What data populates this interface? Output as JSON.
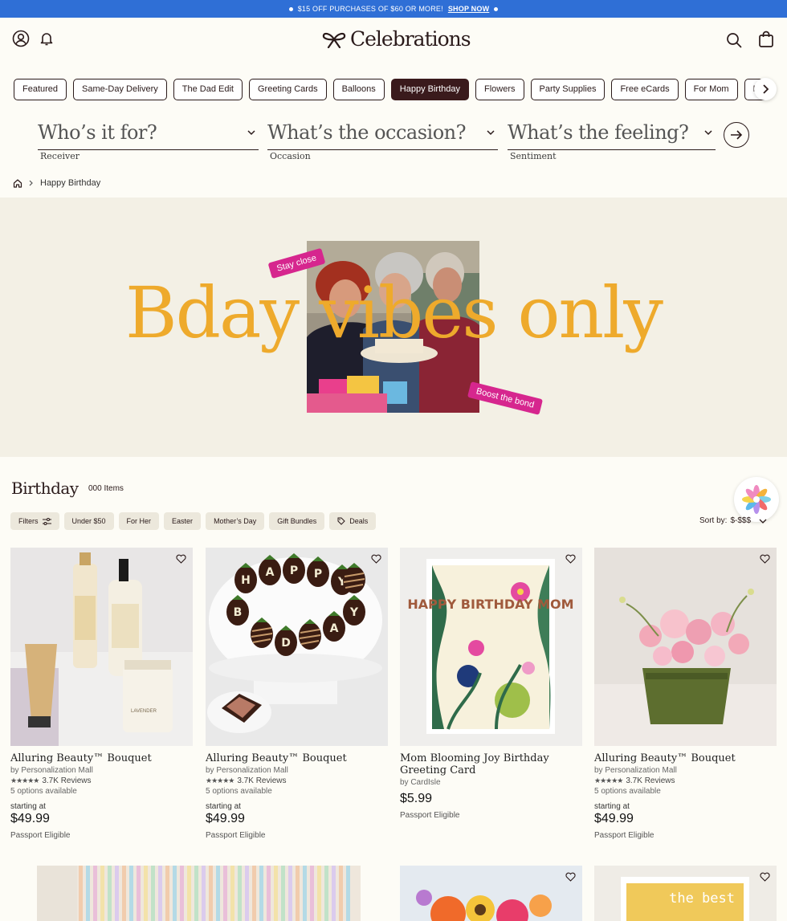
{
  "promo": {
    "text": "$15 OFF PURCHASES OF $60 OR MORE!",
    "link": "SHOP NOW"
  },
  "header": {
    "brand": "Celebrations"
  },
  "categories": [
    "Featured",
    "Same-Day Delivery",
    "The Dad Edit",
    "Greeting Cards",
    "Balloons",
    "Happy Birthday",
    "Flowers",
    "Party Supplies",
    "Free eCards",
    "For Mom",
    "P"
  ],
  "active_category": "Happy Birthday",
  "finder": [
    {
      "placeholder": "Who’s it for?",
      "label": "Receiver"
    },
    {
      "placeholder": "What’s the occasion?",
      "label": "Occasion"
    },
    {
      "placeholder": "What’s the feeling?",
      "label": "Sentiment"
    }
  ],
  "breadcrumb": {
    "current": "Happy Birthday"
  },
  "hero": {
    "title": "Bday vibes only",
    "sticker1": "Stay close",
    "sticker2": "Boost the bond"
  },
  "listing": {
    "title": "Birthday",
    "count": "000 Items",
    "sort_label": "Sort by:",
    "sort_value": "$-$$$"
  },
  "filters": [
    "Filters",
    "Under $50",
    "For Her",
    "Easter",
    "Mother’s Day",
    "Gift Bundles",
    "Deals"
  ],
  "products": [
    {
      "title": "Alluring Beauty™ Bouquet",
      "by": "by Personalization Mall",
      "reviews": "3.7K Reviews",
      "options": "5 options available",
      "starting": "starting at",
      "price": "$49.99",
      "passport": "Passport Eligible"
    },
    {
      "title": "Alluring Beauty™ Bouquet",
      "by": "by Personalization Mall",
      "reviews": "3.7K Reviews",
      "options": "5 options available",
      "starting": "starting at",
      "price": "$49.99",
      "passport": "Passport Eligible"
    },
    {
      "title": "Mom Blooming Joy Birthday Greeting Card",
      "by": "by CardIsle",
      "price": "$5.99",
      "passport": "Passport Eligible"
    },
    {
      "title": "Alluring Beauty™ Bouquet",
      "by": "by Personalization Mall",
      "reviews": "3.7K Reviews",
      "options": "5 options available",
      "starting": "starting at",
      "price": "$49.99",
      "passport": "Passport Eligible"
    }
  ],
  "images": {
    "card_text": "HAPPY BIRTHDAY MOM",
    "strawberry_letters": [
      "H",
      "A",
      "P",
      "P",
      "Y",
      "B",
      "D",
      "A",
      "Y"
    ],
    "lotion_label": "LAVENDER",
    "card_partial": "the best"
  },
  "colors": {
    "promo_bar": "#2f6fd6",
    "accent_pink": "#d6268e",
    "hero_text": "#eeaa2c",
    "active_chip": "#3a1a1c"
  }
}
